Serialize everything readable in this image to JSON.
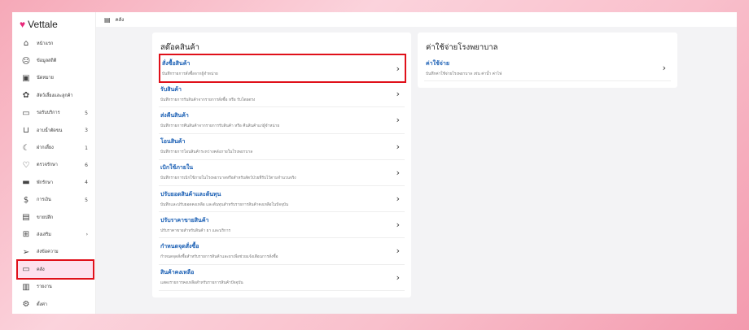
{
  "app": {
    "name": "Vettale"
  },
  "header": {
    "title": "คลัง"
  },
  "sidebar": {
    "items": [
      {
        "label": "หน้าแรก",
        "icon": "home-icon",
        "count": ""
      },
      {
        "label": "ข้อมูลสถิติ",
        "icon": "stats-icon",
        "count": ""
      },
      {
        "label": "นัดหมาย",
        "icon": "calendar-icon",
        "count": ""
      },
      {
        "label": "สัตว์เลี้ยงและลูกค้า",
        "icon": "paw-icon",
        "count": ""
      },
      {
        "label": "รอรับบริการ",
        "icon": "sofa-icon",
        "count": "5"
      },
      {
        "label": "อาบน้ำตัดขน",
        "icon": "bath-icon",
        "count": "3"
      },
      {
        "label": "ฝากเลี้ยง",
        "icon": "moon-icon",
        "count": "1"
      },
      {
        "label": "ตรวจรักษา",
        "icon": "stethoscope-icon",
        "count": "6"
      },
      {
        "label": "พักรักษา",
        "icon": "bed-icon",
        "count": "4"
      },
      {
        "label": "การเงิน",
        "icon": "money-icon",
        "count": "5"
      },
      {
        "label": "ขายปลีก",
        "icon": "register-icon",
        "count": ""
      },
      {
        "label": "ส่งเสริม",
        "icon": "promotion-icon",
        "count": "›"
      },
      {
        "label": "ส่งข้อความ",
        "icon": "send-icon",
        "count": ""
      },
      {
        "label": "คลัง",
        "icon": "archive-icon",
        "count": ""
      },
      {
        "label": "รายงาน",
        "icon": "report-icon",
        "count": ""
      },
      {
        "label": "ตั้งค่า",
        "icon": "gear-icon",
        "count": ""
      }
    ]
  },
  "stock": {
    "title": "สต๊อคสินค้า",
    "items": [
      {
        "title": "สั่งซื้อสินค้า",
        "desc": "บันทึกรายการสั่งซื้อจากผู้จำหน่าย"
      },
      {
        "title": "รับสินค้า",
        "desc": "บันทึกรายการรับสินค้าจากรายการสั่งซื้อ หรือ รับโดยตรง"
      },
      {
        "title": "ส่งคืนสินค้า",
        "desc": "บันทึกรายการคืนสินค้าจากรายการรับสินค้า หรือ คืนสินค้าแก่ผู้จำหน่าย"
      },
      {
        "title": "โอนสินค้า",
        "desc": "บันทึกรายการโอนสินค้าระหว่างคลังภายในโรงพยาบาล"
      },
      {
        "title": "เบิกใช้ภายใน",
        "desc": "บันทึกรายการเบิกใช้ภายในโรงพยาบาลหรือสำหรับสัตว์ป่วยที่รับไว้ตามจำนวนจริง"
      },
      {
        "title": "ปรับยอดสินค้าและต้นทุน",
        "desc": "บันทึกและปรับยอดคงเหลือ และต้นทุนสำหรับรายการสินค้าคงเหลือในปัจจุบัน"
      },
      {
        "title": "ปรับราคาขายสินค้า",
        "desc": "ปรับราคาขายสำหรับสินค้า ยา และบริการ"
      },
      {
        "title": "กำหนดจุดสั่งซื้อ",
        "desc": "กำหนดจุดสั่งซื้อสำหรับรายการสินค้าและยาเพื่อช่วยแจ้งเตือนการสั่งซื้อ"
      },
      {
        "title": "สินค้าคงเหลือ",
        "desc": "แสดงรายการคงเหลือสำหรับรายการสินค้าปัจจุบัน"
      }
    ]
  },
  "expense": {
    "title": "ค่าใช้จ่ายโรงพยาบาล",
    "items": [
      {
        "title": "ค่าใช้จ่าย",
        "desc": "บันทึกค่าใช้จ่ายโรงพยาบาล เช่น ค่าน้ำ ค่าไฟ"
      }
    ]
  }
}
